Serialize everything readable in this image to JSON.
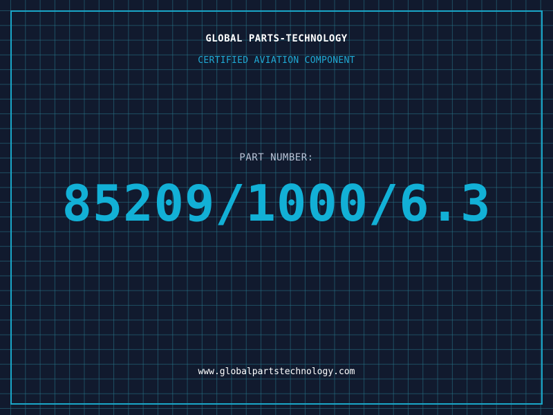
{
  "company_name": "GLOBAL PARTS-TECHNOLOGY",
  "subtitle": "CERTIFIED AVIATION COMPONENT",
  "part_label": "PART NUMBER:",
  "part_number": "85209/1000/6.3",
  "website": "www.globalpartstechnology.com",
  "colors": {
    "background": "#111a2e",
    "grid": "#28788c",
    "border": "#1aa7c9",
    "accent": "#12b0d6",
    "subtitle": "#1fa9d4",
    "label": "#b9c3d6",
    "text": "#ffffff"
  }
}
